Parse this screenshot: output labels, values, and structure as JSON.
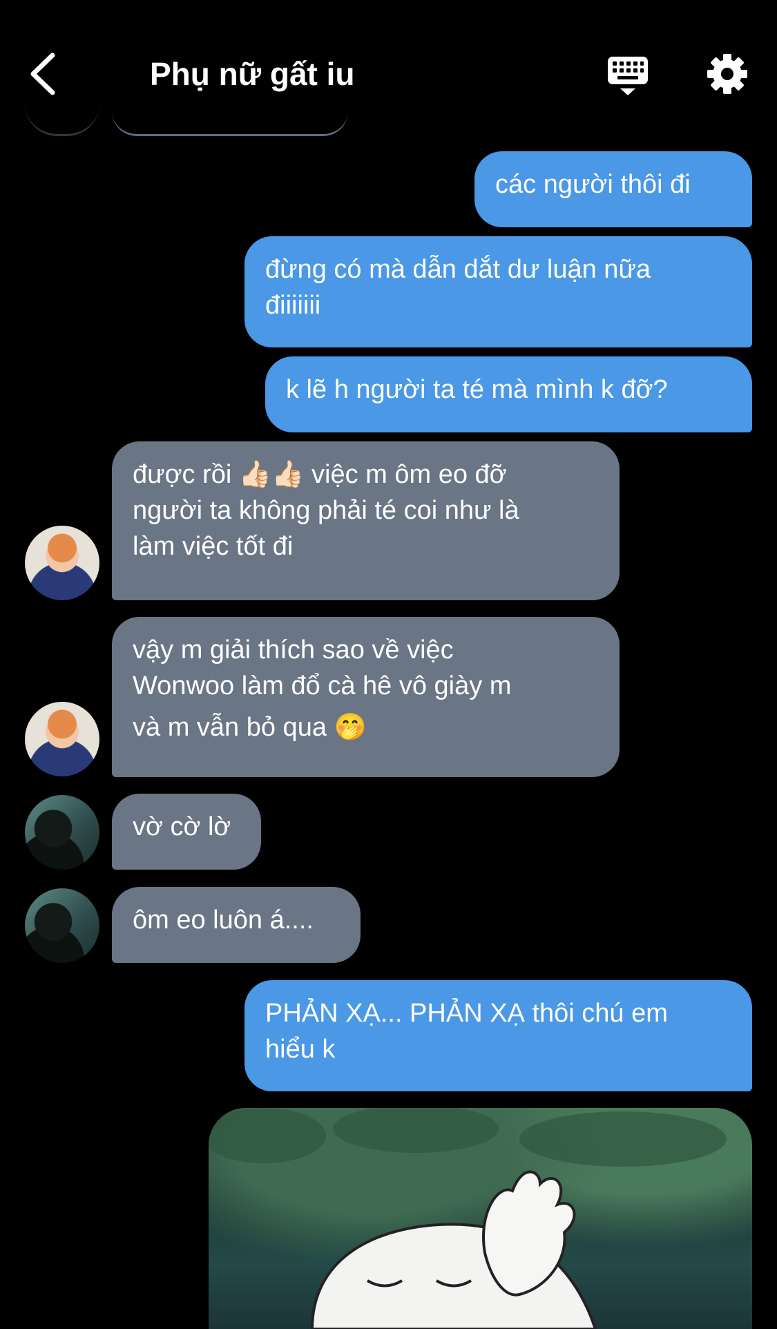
{
  "header": {
    "title": "Phụ nữ gất iu",
    "back_icon": "chevron-left-icon",
    "keyboard_icon": "keyboard-icon",
    "settings_icon": "gear-icon"
  },
  "messages": [
    {
      "side": "out",
      "lines": [
        "các người thôi đi"
      ]
    },
    {
      "side": "out",
      "lines": [
        "đừng có mà dẫn dắt dư luận nữa",
        "điiiiiii"
      ]
    },
    {
      "side": "out",
      "lines": [
        "k lẽ h người ta té mà mình k đỡ?"
      ]
    },
    {
      "side": "in",
      "avatar": "avatar-a",
      "lines": [
        "được rồi 👍🏻👍🏻 việc m ôm eo đỡ",
        "người ta không phải té coi như là",
        "làm việc tốt đi"
      ]
    },
    {
      "side": "in",
      "avatar": "avatar-a",
      "lines": [
        "vậy m giải thích sao về việc",
        "Wonwoo làm đổ cà hê vô giày m",
        "và m vẫn bỏ qua 🤭"
      ]
    },
    {
      "side": "in",
      "avatar": "avatar-b",
      "lines": [
        "vờ cờ lờ"
      ]
    },
    {
      "side": "in",
      "avatar": "avatar-b",
      "lines": [
        "ôm eo luôn á...."
      ]
    },
    {
      "side": "out",
      "lines": [
        "PHẢN XẠ... PHẢN XẠ thôi chú em",
        "hiểu k"
      ]
    }
  ],
  "image_message": {
    "description_icon": "sticker-image"
  },
  "colors": {
    "background": "#000000",
    "outgoing_bubble": "#4a98e6",
    "incoming_bubble": "#6a7585",
    "text": "#ffffff"
  }
}
